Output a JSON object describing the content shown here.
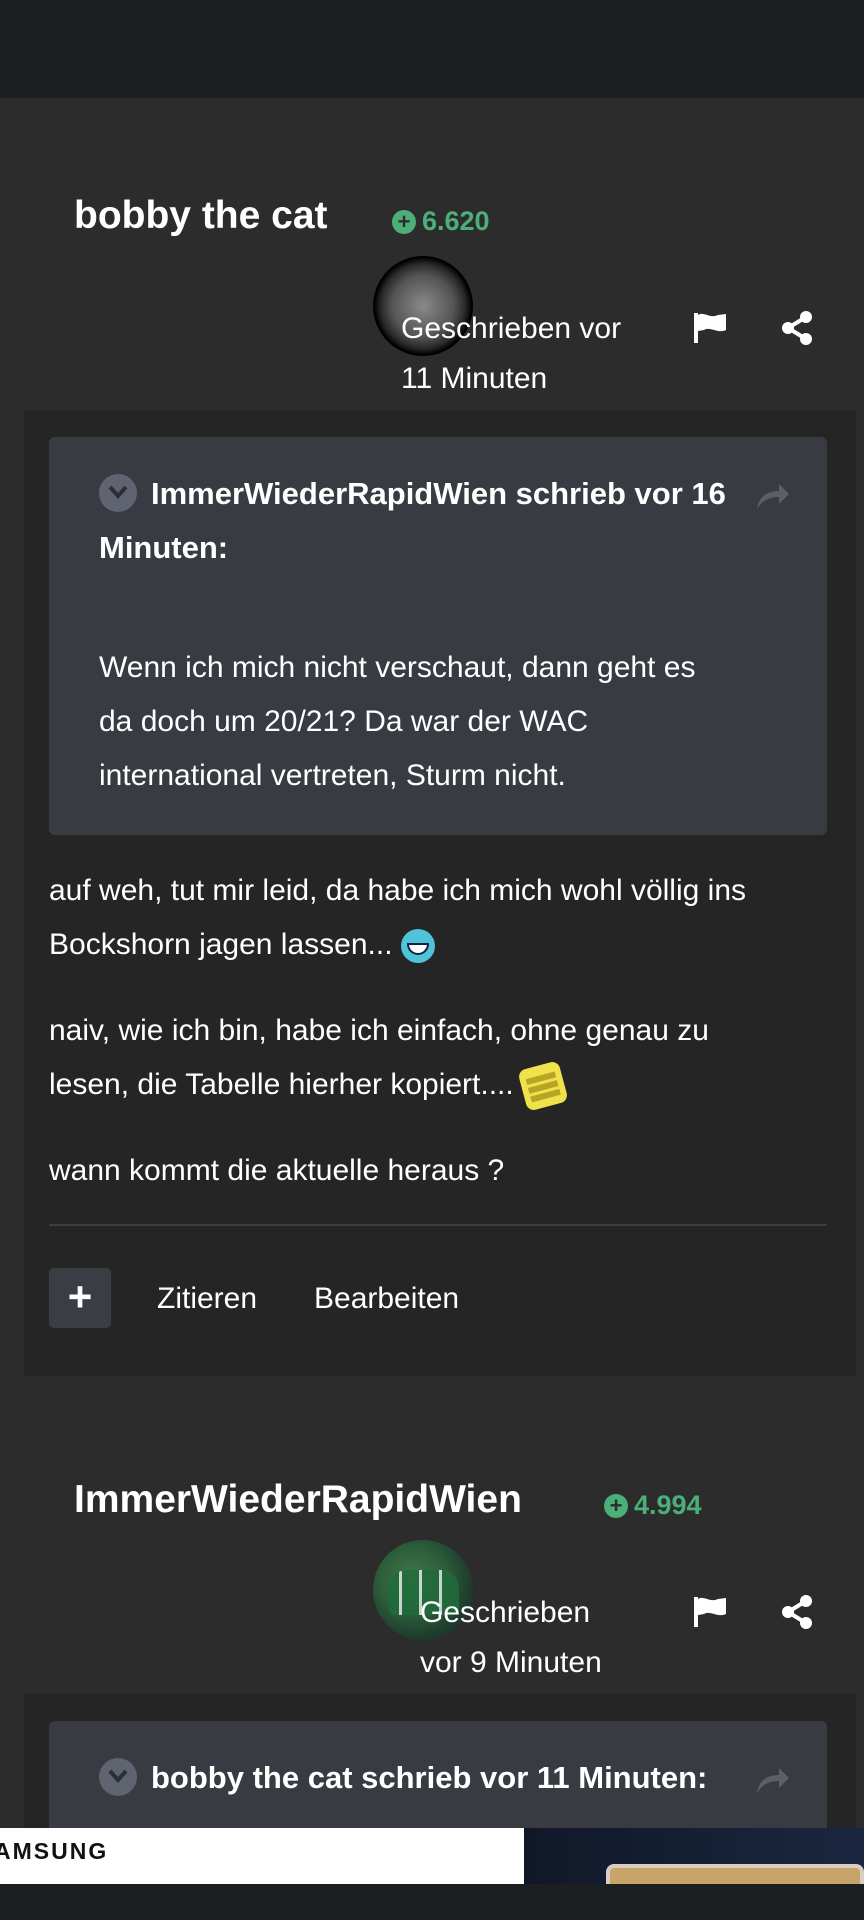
{
  "post1": {
    "author": "bobby the cat",
    "reputation": "6.620",
    "written_line1": "Geschrieben vor",
    "written_line2": "11 Minuten",
    "quote": {
      "header_line1": "ImmerWiederRapidWien schrieb vor 16",
      "header_line2": "Minuten:",
      "body": [
        "Wenn ich mich nicht verschaut, dann geht es",
        "da doch um 20/21? Da war der WAC",
        "international vertreten, Sturm nicht."
      ]
    },
    "paragraphs": [
      {
        "line1": "auf weh, tut mir leid, da habe ich mich wohl völlig ins",
        "line2": "Bockshorn jagen lassen...",
        "emoji": "laughing-emoji"
      },
      {
        "line1": "naiv, wie ich bin, habe ich einfach, ohne genau zu",
        "line2": "lesen, die Tabelle hierher kopiert....",
        "emoji": "facepalm-emoji"
      },
      {
        "line1": "wann kommt die aktuelle heraus ?"
      }
    ],
    "actions": {
      "plus": "+",
      "quote": "Zitieren",
      "edit": "Bearbeiten"
    }
  },
  "post2": {
    "author": "ImmerWiederRapidWien",
    "reputation": "4.994",
    "written_line1": "Geschrieben",
    "written_line2": "vor 9 Minuten",
    "quote": {
      "header": "bobby the cat schrieb vor 11 Minuten:"
    }
  },
  "ad": {
    "brand_text": "AMSUNG"
  },
  "colors": {
    "reputation": "#4caf7a",
    "background": "#2c2c2c",
    "quote_bg": "#383c42"
  },
  "icons": [
    "plus-circle-icon",
    "flag-icon",
    "share-icon",
    "chevron-down-icon",
    "share-forward-icon"
  ]
}
